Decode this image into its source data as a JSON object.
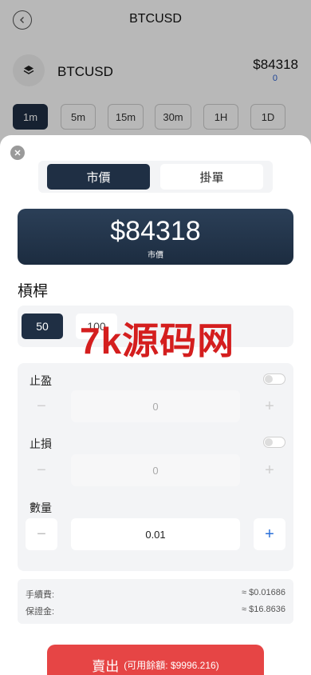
{
  "header": {
    "title": "BTCUSD"
  },
  "ticker": {
    "name": "BTCUSD",
    "price": "$84318",
    "change": "0"
  },
  "timeframes": [
    "1m",
    "5m",
    "15m",
    "30m",
    "1H",
    "1D"
  ],
  "order_types": {
    "market": "市價",
    "limit": "掛單",
    "selected": "market"
  },
  "price_card": {
    "price": "$84318",
    "label": "市價"
  },
  "leverage": {
    "title": "槓桿",
    "options": [
      "50",
      "100"
    ],
    "selected": "50"
  },
  "take_profit": {
    "label": "止盈",
    "value": "0",
    "enabled": false
  },
  "stop_loss": {
    "label": "止損",
    "value": "0",
    "enabled": false
  },
  "quantity": {
    "label": "數量",
    "value": "0.01"
  },
  "fees": {
    "fee_label": "手續費:",
    "fee_value": "≈ $0.01686",
    "margin_label": "保證金:",
    "margin_value": "≈ $16.8636"
  },
  "sell_button": {
    "label": "賣出",
    "available": "(可用餘額: $9996.216)"
  },
  "watermark": "7k源码网",
  "colors": {
    "navy": "#1f2f44",
    "sell_red": "#e64545",
    "plus_blue": "#2a6fd8"
  },
  "icons": {
    "back": "chevron-left-icon",
    "ticker": "layers-icon",
    "close": "close-icon"
  }
}
